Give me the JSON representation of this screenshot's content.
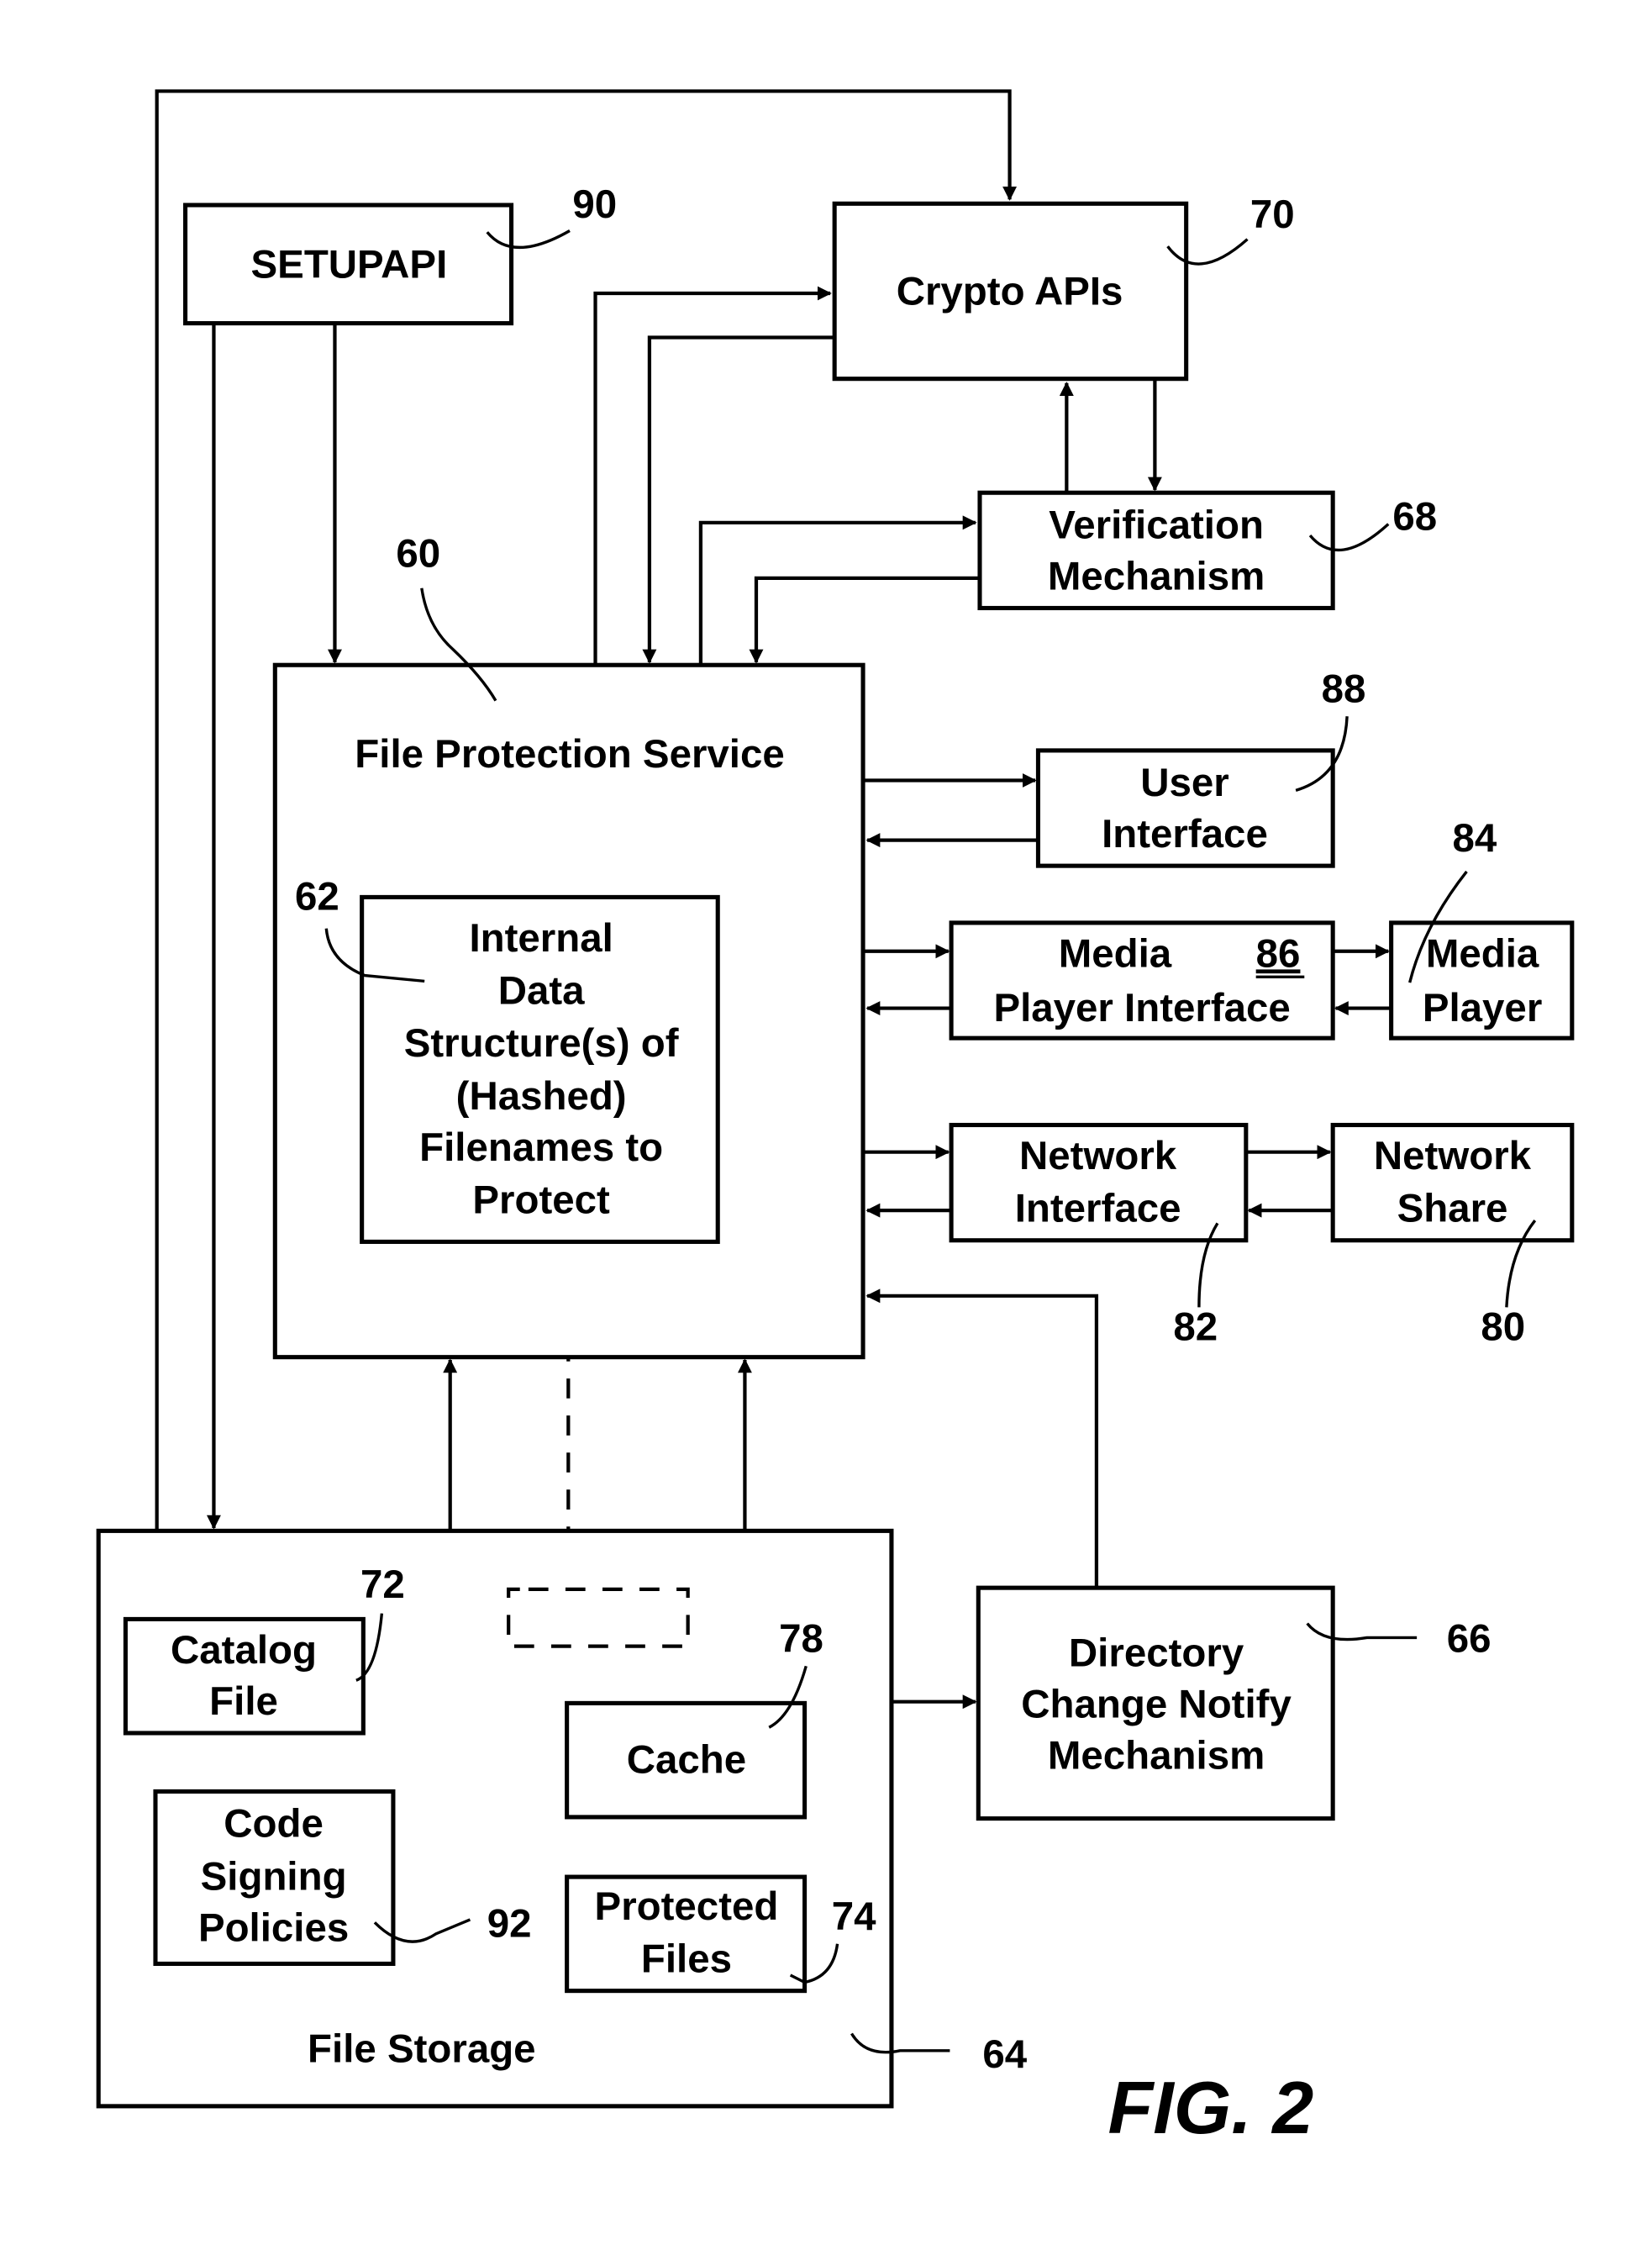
{
  "figure": {
    "label": "FIG. 2"
  },
  "blocks": {
    "setupapi": {
      "lines": [
        "SETUPAPI"
      ],
      "ref": "90"
    },
    "crypto": {
      "lines": [
        "Crypto APIs"
      ],
      "ref": "70"
    },
    "verification": {
      "lines": [
        "Verification",
        "Mechanism"
      ],
      "ref": "68"
    },
    "fps": {
      "lines": [
        "File Protection Service"
      ],
      "ref": "60"
    },
    "internal": {
      "lines": [
        "Internal",
        "Data",
        "Structure(s) of",
        "(Hashed)",
        "Filenames to",
        "Protect"
      ],
      "ref": "62"
    },
    "user_interface": {
      "lines": [
        "User",
        "Interface"
      ],
      "ref": "88"
    },
    "media_player_interface": {
      "lines": [
        "Media",
        "Player Interface"
      ],
      "ref": "86"
    },
    "media_player": {
      "lines": [
        "Media",
        "Player"
      ],
      "ref": "84"
    },
    "network_interface": {
      "lines": [
        "Network",
        "Interface"
      ],
      "ref": "82"
    },
    "network_share": {
      "lines": [
        "Network",
        "Share"
      ],
      "ref": "80"
    },
    "file_storage": {
      "lines": [
        "File Storage"
      ],
      "ref": "64"
    },
    "catalog": {
      "lines": [
        "Catalog",
        "File"
      ],
      "ref": "72"
    },
    "code_signing": {
      "lines": [
        "Code",
        "Signing",
        "Policies"
      ],
      "ref": "92"
    },
    "cache": {
      "lines": [
        "Cache"
      ],
      "ref": "78"
    },
    "protected_files": {
      "lines": [
        "Protected",
        "Files"
      ],
      "ref": "74"
    },
    "dir_change": {
      "lines": [
        "Directory",
        "Change Notify",
        "Mechanism"
      ],
      "ref": "66"
    }
  }
}
